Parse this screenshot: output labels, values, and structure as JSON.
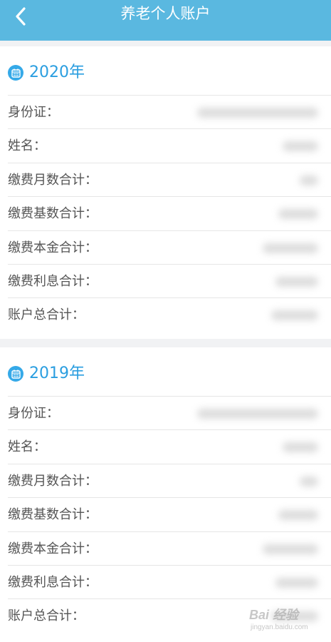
{
  "header": {
    "title": "养老个人账户"
  },
  "sections": [
    {
      "year": "2020年",
      "rows": [
        {
          "label": "身份证："
        },
        {
          "label": "姓名："
        },
        {
          "label": "缴费月数合计："
        },
        {
          "label": "缴费基数合计："
        },
        {
          "label": "缴费本金合计："
        },
        {
          "label": "缴费利息合计："
        },
        {
          "label": "账户总合计："
        }
      ]
    },
    {
      "year": "2019年",
      "rows": [
        {
          "label": "身份证："
        },
        {
          "label": "姓名："
        },
        {
          "label": "缴费月数合计："
        },
        {
          "label": "缴费基数合计："
        },
        {
          "label": "缴费本金合计："
        },
        {
          "label": "缴费利息合计："
        },
        {
          "label": "账户总合计："
        }
      ]
    }
  ],
  "watermark": {
    "main": "Bai 经验",
    "sub": "jingyan.baidu.com"
  },
  "colors": {
    "header_bg": "#5ab8e0",
    "accent": "#2a9ee0",
    "label": "#555555",
    "divider": "#e6e6e6"
  },
  "icons": {
    "back": "chevron-left-icon",
    "year": "calendar-icon"
  }
}
